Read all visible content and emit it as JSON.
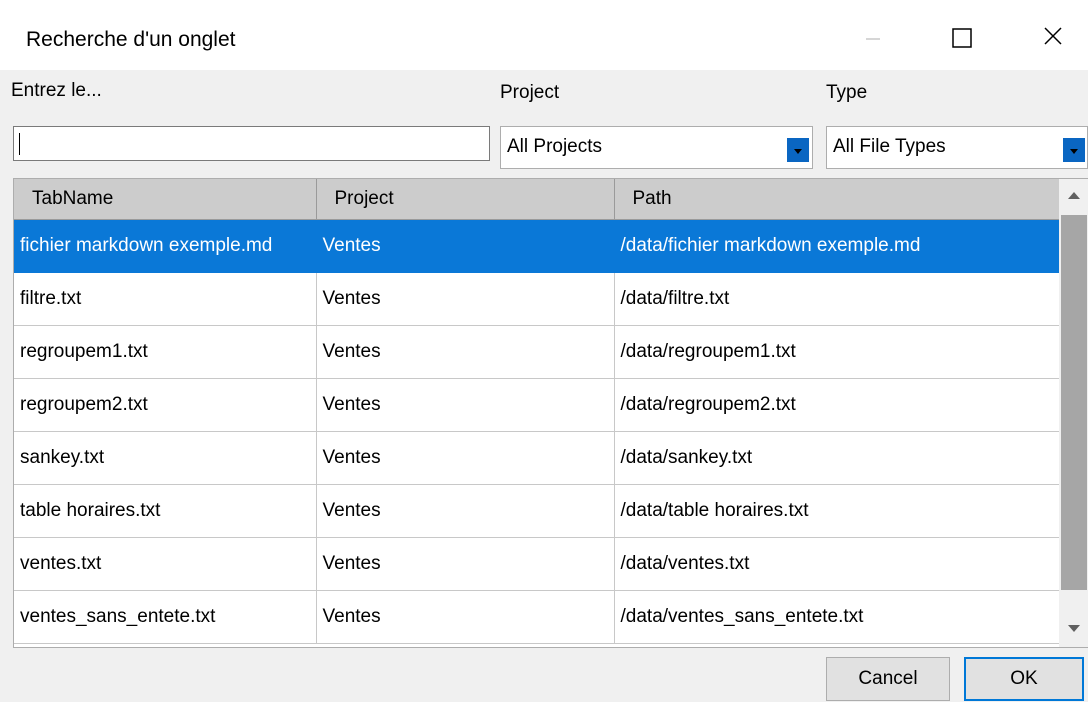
{
  "window": {
    "title": "Recherche d'un onglet",
    "controls": [
      "minimize-icon",
      "maximize-icon",
      "close-icon"
    ]
  },
  "filters": {
    "search_label": "Entrez le...",
    "search_value": "",
    "project_label": "Project",
    "project_value": "All Projects",
    "type_label": "Type",
    "type_value": "All File Types"
  },
  "grid": {
    "columns": [
      "TabName",
      "Project",
      "Path"
    ],
    "rows": [
      {
        "name": "fichier markdown exemple.md",
        "project": "Ventes",
        "path": "/data/fichier markdown exemple.md",
        "selected": true
      },
      {
        "name": "filtre.txt",
        "project": "Ventes",
        "path": "/data/filtre.txt"
      },
      {
        "name": "regroupem1.txt",
        "project": "Ventes",
        "path": "/data/regroupem1.txt"
      },
      {
        "name": "regroupem2.txt",
        "project": "Ventes",
        "path": "/data/regroupem2.txt"
      },
      {
        "name": "sankey.txt",
        "project": "Ventes",
        "path": "/data/sankey.txt"
      },
      {
        "name": "table horaires.txt",
        "project": "Ventes",
        "path": "/data/table horaires.txt"
      },
      {
        "name": "ventes.txt",
        "project": "Ventes",
        "path": "/data/ventes.txt"
      },
      {
        "name": "ventes_sans_entete.txt",
        "project": "Ventes",
        "path": "/data/ventes_sans_entete.txt"
      }
    ]
  },
  "buttons": {
    "cancel": "Cancel",
    "ok": "OK"
  },
  "colors": {
    "selection": "#0a78d7",
    "accent": "#0078d7",
    "header": "#cccccc"
  }
}
